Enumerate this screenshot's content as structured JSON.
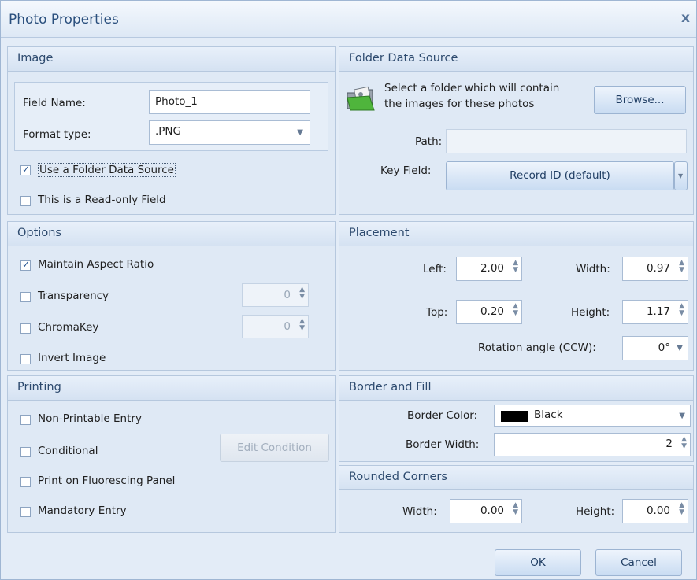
{
  "window": {
    "title": "Photo Properties",
    "close_glyph": "x"
  },
  "image": {
    "header": "Image",
    "field_name_label": "Field Name:",
    "field_name_value": "Photo_1",
    "format_label": "Format type:",
    "format_value": ".PNG",
    "use_folder_label": "Use a Folder Data Source",
    "use_folder_checked": true,
    "readonly_label": "This is a Read-only Field",
    "readonly_checked": false
  },
  "folder": {
    "header": "Folder Data Source",
    "description_line1": "Select a folder which will contain",
    "description_line2": "the images for these photos",
    "browse_label": "Browse...",
    "path_label": "Path:",
    "path_value": "",
    "key_field_label": "Key Field:",
    "key_field_value": "Record ID (default)"
  },
  "options": {
    "header": "Options",
    "maintain_aspect_label": "Maintain Aspect Ratio",
    "maintain_aspect_checked": true,
    "transparency_label": "Transparency",
    "transparency_value": "0",
    "chromakey_label": "ChromaKey",
    "chromakey_value": "0",
    "invert_label": "Invert Image"
  },
  "placement": {
    "header": "Placement",
    "left_label": "Left:",
    "left_value": "2.00",
    "width_label": "Width:",
    "width_value": "0.97",
    "top_label": "Top:",
    "top_value": "0.20",
    "height_label": "Height:",
    "height_value": "1.17",
    "rotation_label": "Rotation angle (CCW):",
    "rotation_value": "0°"
  },
  "printing": {
    "header": "Printing",
    "non_printable_label": "Non-Printable Entry",
    "conditional_label": "Conditional",
    "edit_condition_label": "Edit Condition",
    "fluorescing_label": "Print on Fluorescing Panel",
    "mandatory_label": "Mandatory Entry"
  },
  "border": {
    "header": "Border and Fill",
    "color_label": "Border Color:",
    "color_value": "Black",
    "color_swatch": "#000000",
    "width_label": "Border Width:",
    "width_value": "2"
  },
  "corners": {
    "header": "Rounded Corners",
    "width_label": "Width:",
    "width_value": "0.00",
    "height_label": "Height:",
    "height_value": "0.00"
  },
  "footer": {
    "ok_label": "OK",
    "cancel_label": "Cancel"
  },
  "icons": {
    "folder_photo": "folder-photo-icon",
    "spinner": "spin-arrows-icon",
    "dropdown": "chevron-down-icon"
  },
  "colors": {
    "accent": "#2a4f7d",
    "panel_bg": "#dfe9f5",
    "window_bg": "#e3ecf7"
  }
}
